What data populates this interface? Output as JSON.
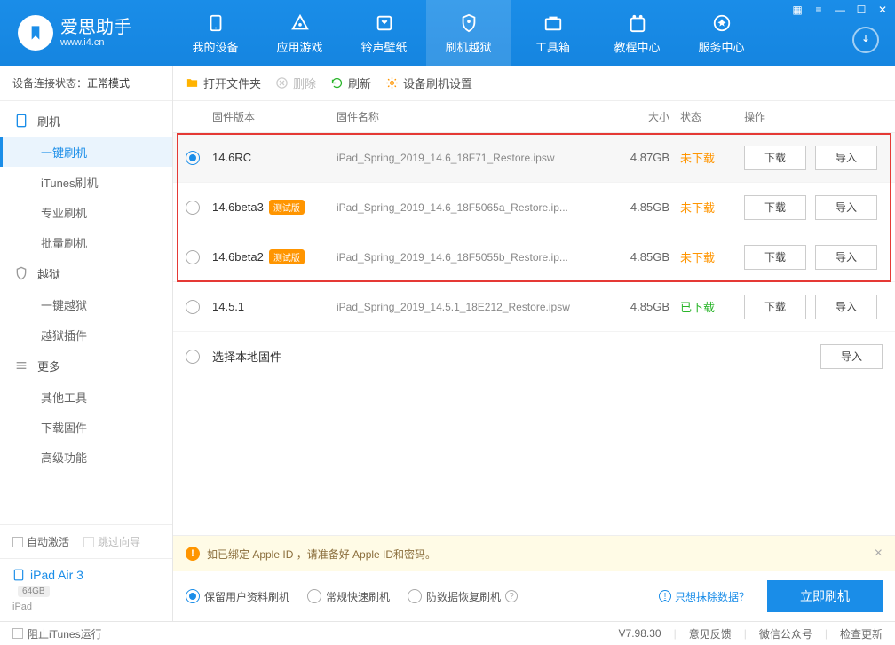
{
  "app": {
    "title": "爱思助手",
    "url": "www.i4.cn"
  },
  "nav": [
    "我的设备",
    "应用游戏",
    "铃声壁纸",
    "刷机越狱",
    "工具箱",
    "教程中心",
    "服务中心"
  ],
  "nav_active": 3,
  "sidebar": {
    "status_label": "设备连接状态：",
    "status_value": "正常模式",
    "groups": [
      {
        "label": "刷机",
        "items": [
          "一键刷机",
          "iTunes刷机",
          "专业刷机",
          "批量刷机"
        ],
        "active": 0
      },
      {
        "label": "越狱",
        "items": [
          "一键越狱",
          "越狱插件"
        ]
      },
      {
        "label": "更多",
        "items": [
          "其他工具",
          "下载固件",
          "高级功能"
        ]
      }
    ],
    "auto_activate": "自动激活",
    "skip_wizard": "跳过向导",
    "device": {
      "name": "iPad Air 3",
      "capacity": "64GB",
      "type": "iPad"
    }
  },
  "toolbar": {
    "open": "打开文件夹",
    "delete": "删除",
    "refresh": "刷新",
    "settings": "设备刷机设置"
  },
  "columns": {
    "ver": "固件版本",
    "name": "固件名称",
    "size": "大小",
    "status": "状态",
    "ops": "操作"
  },
  "rows": [
    {
      "ver": "14.6RC",
      "beta": false,
      "name": "iPad_Spring_2019_14.6_18F71_Restore.ipsw",
      "size": "4.87GB",
      "status": "未下载",
      "st": "nd",
      "sel": true,
      "dl": true
    },
    {
      "ver": "14.6beta3",
      "beta": true,
      "name": "iPad_Spring_2019_14.6_18F5065a_Restore.ip...",
      "size": "4.85GB",
      "status": "未下载",
      "st": "nd",
      "sel": false,
      "dl": true
    },
    {
      "ver": "14.6beta2",
      "beta": true,
      "name": "iPad_Spring_2019_14.6_18F5055b_Restore.ip...",
      "size": "4.85GB",
      "status": "未下载",
      "st": "nd",
      "sel": false,
      "dl": true
    },
    {
      "ver": "14.5.1",
      "beta": false,
      "name": "iPad_Spring_2019_14.5.1_18E212_Restore.ipsw",
      "size": "4.85GB",
      "status": "已下载",
      "st": "dd",
      "sel": false,
      "dl": true
    }
  ],
  "beta_tag": "测试版",
  "local_row": "选择本地固件",
  "btn": {
    "download": "下载",
    "import": "导入"
  },
  "warn": "如已绑定 Apple ID ，请准备好 Apple ID和密码。",
  "flash": {
    "opts": [
      "保留用户资料刷机",
      "常规快速刷机",
      "防数据恢复刷机"
    ],
    "active": 0,
    "erase": "只想抹除数据？",
    "go": "立即刷机"
  },
  "footer": {
    "stop_itunes": "阻止iTunes运行",
    "version": "V7.98.30",
    "feedback": "意见反馈",
    "wechat": "微信公众号",
    "update": "检查更新"
  }
}
